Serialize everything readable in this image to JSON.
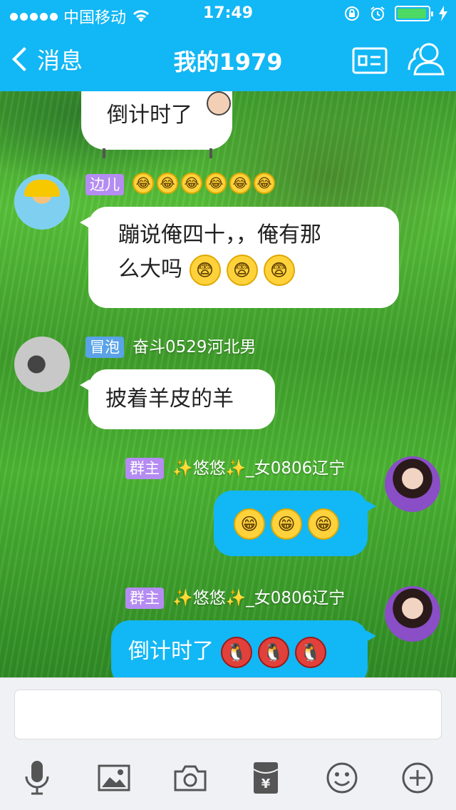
{
  "status_bar": {
    "carrier": "中国移动",
    "time": "17:49"
  },
  "nav": {
    "back_label": "消息",
    "title": "我的1979"
  },
  "messages": [
    {
      "text": "倒计时了"
    },
    {
      "badge": "边儿",
      "text_line1": "蹦说俺四十，，俺有那",
      "text_line2": "么大吗"
    },
    {
      "badge": "冒泡",
      "nickname": "奋斗0529河北男",
      "text": "披着羊皮的羊"
    },
    {
      "badge": "群主",
      "nickname": "✨悠悠✨_女0806辽宁"
    },
    {
      "badge": "群主",
      "nickname": "✨悠悠✨_女0806辽宁",
      "text": "倒计时了"
    }
  ],
  "toolbar": [
    "microphone-icon",
    "image-icon",
    "camera-icon",
    "red-packet-icon",
    "emoji-icon",
    "plus-icon"
  ],
  "colors": {
    "accent": "#12b7f5",
    "badge_purple": "#b48cf2",
    "badge_blue": "#5aa3e8"
  }
}
